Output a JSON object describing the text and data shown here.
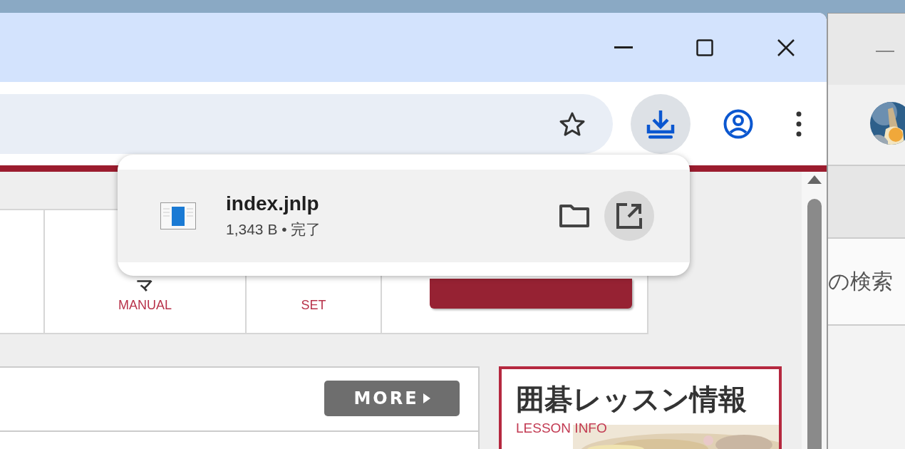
{
  "toolbar": {
    "download_button": {
      "active": true
    }
  },
  "downloads_popup": {
    "items": [
      {
        "name": "index.jnlp",
        "status": "1,343 B • 完了",
        "open_highlighted": true
      }
    ]
  },
  "page": {
    "nav": [
      {
        "label": "マ",
        "sublabel": "MANUAL"
      },
      {
        "sublabel": "SET"
      }
    ],
    "more_button": "MORE",
    "lesson_card": {
      "title": "囲碁レッスン情報",
      "subtitle": "LESSON INFO"
    }
  },
  "background_window": {
    "search_text": "の検索"
  }
}
